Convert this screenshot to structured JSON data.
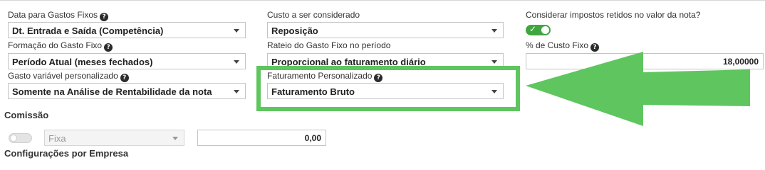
{
  "fields": {
    "data_gastos_fixos": {
      "label": "Data para Gastos Fixos",
      "value": "Dt. Entrada e Saída (Competência)"
    },
    "custo_considerado": {
      "label": "Custo a ser considerado",
      "value": "Reposição"
    },
    "impostos_retidos": {
      "label": "Considerar impostos retidos no valor da nota?",
      "check": "✓"
    },
    "formacao_gasto_fixo": {
      "label": "Formação do Gasto Fixo",
      "value": "Período Atual (meses fechados)"
    },
    "rateio_gasto_fixo": {
      "label": "Rateio do Gasto Fixo no período",
      "value": "Proporcional ao faturamento diário"
    },
    "percent_custo_fixo": {
      "label": "% de Custo Fixo",
      "value": "18,00000"
    },
    "gasto_variavel": {
      "label": "Gasto variável personalizado",
      "value": "Somente na Análise de Rentabilidade da nota"
    },
    "faturamento_personalizado": {
      "label": "Faturamento Personalizado",
      "value": "Faturamento Bruto"
    }
  },
  "comissao": {
    "title": "Comissão",
    "tipo": "Fixa",
    "valor": "0,00"
  },
  "next_section": {
    "title": "Configurações por Empresa"
  },
  "help_glyph": "?",
  "colors": {
    "highlight": "#5fc65f",
    "toggle_on": "#3fa63f"
  }
}
